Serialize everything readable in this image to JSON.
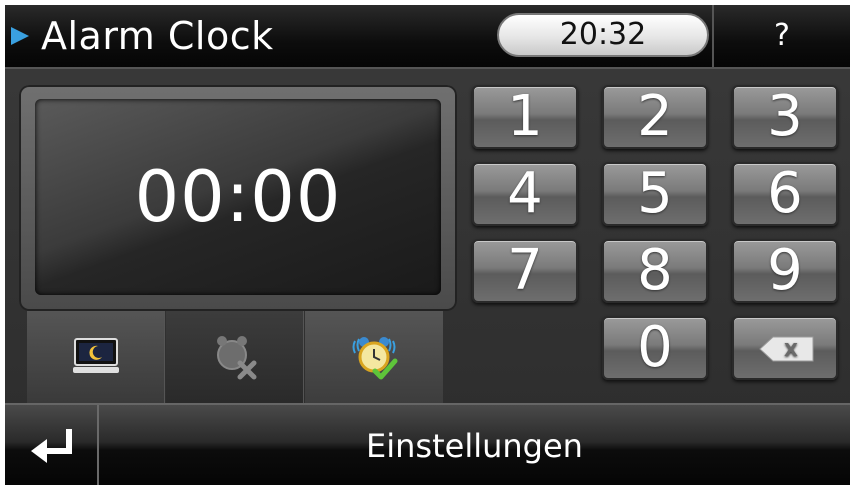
{
  "header": {
    "title": "Alarm Clock",
    "current_time": "20:32",
    "help_label": "?"
  },
  "display": {
    "alarm_time": "00:00"
  },
  "keypad": {
    "keys": [
      "1",
      "2",
      "3",
      "4",
      "5",
      "6",
      "7",
      "8",
      "9",
      "0"
    ],
    "backspace_icon": "backspace-icon"
  },
  "modes": {
    "tabs": [
      {
        "icon": "standby-night-icon"
      },
      {
        "icon": "alarm-off-icon"
      },
      {
        "icon": "alarm-on-icon"
      }
    ]
  },
  "footer": {
    "back_icon": "return-arrow-icon",
    "settings_label": "Einstellungen"
  },
  "colors": {
    "accent_arrow": "#3aa0e0",
    "checkmark": "#5ec43a",
    "background": "#2c2c2c"
  }
}
